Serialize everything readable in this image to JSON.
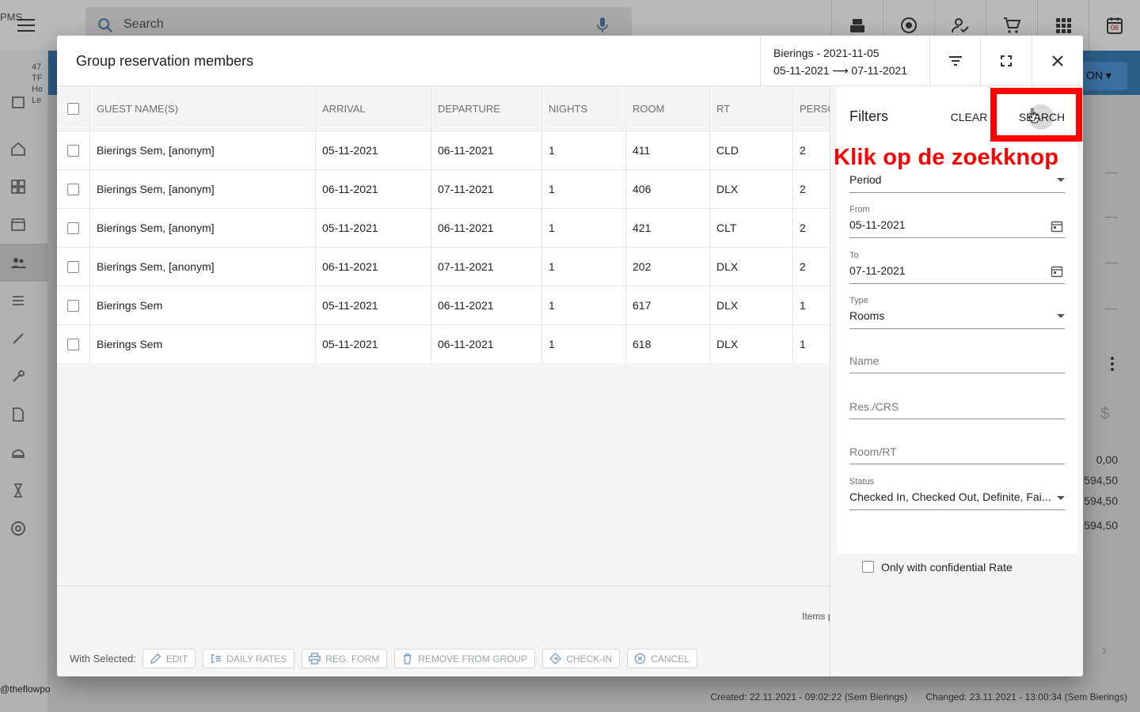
{
  "app": {
    "brand": "PMS",
    "search_placeholder": "Search",
    "side_info": [
      "47",
      "TF",
      "He",
      "Le"
    ],
    "footer_handle": "@theflowpo",
    "created": "Created: 22.11.2021 - 09:02:22 (Sem Bierings)",
    "changed": "Changed: 23.11.2021 - 13:00:34 (Sem Bierings)",
    "bg_button": "ON",
    "bg_values": [
      "0,00",
      "594,50",
      "594,50",
      "594,50"
    ],
    "calendar_day": "06"
  },
  "dialog": {
    "title": "Group reservation members",
    "group_name": "Bierings - 2021-11-05",
    "group_range": "05-11-2021 ⟶ 07-11-2021",
    "columns": [
      "GUEST NAME(S)",
      "ARRIVAL",
      "DEPARTURE",
      "NIGHTS",
      "ROOM",
      "RT",
      "PERSO"
    ],
    "rows": [
      {
        "name": "Bierings Sem, [anonym]",
        "arrival": "05-11-2021",
        "departure": "06-11-2021",
        "nights": "1",
        "room": "411",
        "rt": "CLD",
        "persons": "2"
      },
      {
        "name": "Bierings Sem, [anonym]",
        "arrival": "06-11-2021",
        "departure": "07-11-2021",
        "nights": "1",
        "room": "406",
        "rt": "DLX",
        "persons": "2"
      },
      {
        "name": "Bierings Sem, [anonym]",
        "arrival": "05-11-2021",
        "departure": "06-11-2021",
        "nights": "1",
        "room": "421",
        "rt": "CLT",
        "persons": "2"
      },
      {
        "name": "Bierings Sem, [anonym]",
        "arrival": "06-11-2021",
        "departure": "07-11-2021",
        "nights": "1",
        "room": "202",
        "rt": "DLX",
        "persons": "2"
      },
      {
        "name": "Bierings Sem",
        "arrival": "05-11-2021",
        "departure": "06-11-2021",
        "nights": "1",
        "room": "617",
        "rt": "DLX",
        "persons": "1"
      },
      {
        "name": "Bierings Sem",
        "arrival": "05-11-2021",
        "departure": "06-11-2021",
        "nights": "1",
        "room": "618",
        "rt": "DLX",
        "persons": "1"
      }
    ],
    "items_label": "Items p",
    "with_selected": "With Selected:",
    "actions": [
      "EDIT",
      "DAILY RATES",
      "REG. FORM",
      "REMOVE FROM GROUP",
      "CHECK-IN",
      "CANCEL"
    ]
  },
  "filters": {
    "title": "Filters",
    "clear_label": "CLEAR",
    "search_label": "SEARCH",
    "period_value": "Period",
    "from_label": "From",
    "from_value": "05-11-2021",
    "to_label": "To",
    "to_value": "07-11-2021",
    "type_label": "Type",
    "type_value": "Rooms",
    "name_placeholder": "Name",
    "res_placeholder": "Res./CRS",
    "room_placeholder": "Room/RT",
    "status_label": "Status",
    "status_value": "Checked In, Checked Out, Definite, Fai...",
    "confidential_label": "Only with confidential Rate"
  },
  "annotation": {
    "text": "Klik op de zoekknop",
    "color": "#ff0000"
  }
}
